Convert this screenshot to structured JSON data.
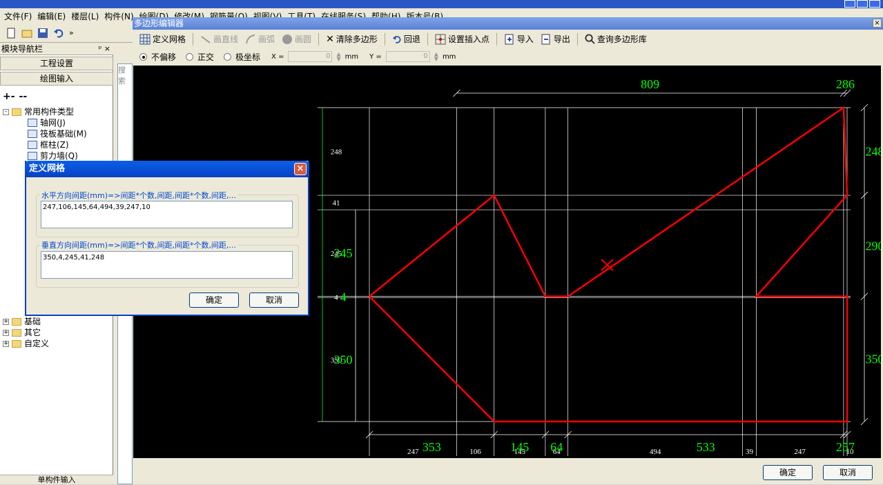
{
  "app": {
    "menu": [
      "文件(F)",
      "编辑(E)",
      "楼层(L)",
      "构件(N)",
      "绘图(D)",
      "修改(M)",
      "钢筋量(Q)",
      "视图(V)",
      "工具(T)",
      "在线服务(S)",
      "帮助(H)",
      "版本号(B)"
    ]
  },
  "nav": {
    "title": "模块导航栏",
    "pin": "ᵖ",
    "close": "×",
    "buttons": [
      "工程设置",
      "绘图输入"
    ],
    "tree": {
      "root": "常用构件类型",
      "children": [
        "轴网(J)",
        "筏板基础(M)",
        "框柱(Z)",
        "剪力墙(Q)"
      ],
      "folders": [
        "基础",
        "其它",
        "自定义"
      ]
    },
    "bottom": "单构件输入",
    "search_hint": "搜索"
  },
  "editor": {
    "title": "多边形编辑器",
    "close": "×",
    "toolbar": {
      "define_grid": "定义网格",
      "draw_line": "画直线",
      "draw_arc": "画弧",
      "draw_circle": "画圆",
      "clear_polygon": "清除多边形",
      "undo": "回退",
      "set_insert_point": "设置插入点",
      "import": "导入",
      "export": "导出",
      "query_library": "查询多边形库"
    },
    "options": {
      "no_offset": "不偏移",
      "orthogonal": "正交",
      "polar": "极坐标",
      "x_label": "X =",
      "x_value": "0",
      "y_label": "Y =",
      "y_value": "0",
      "unit": "mm",
      "selected": "no_offset"
    },
    "ok": "确定",
    "cancel": "取消"
  },
  "canvas_data": {
    "h_spacing": [
      247,
      106,
      145,
      64,
      494,
      39,
      247,
      10
    ],
    "v_spacing_bottom_up": [
      350,
      4,
      245,
      41,
      248
    ],
    "grid_labels_bottom": [
      "247",
      "106",
      "145",
      "64",
      "494",
      "39",
      "247",
      "10"
    ],
    "grid_labels_left": [
      "248",
      "41",
      "245",
      "4",
      "350"
    ],
    "dim_top": [
      "809",
      "286"
    ],
    "dim_bottom": [
      "353",
      "145",
      "64",
      "533",
      "257"
    ],
    "dim_left": [
      "245",
      "4",
      "350"
    ],
    "dim_right": [
      "248",
      "290",
      "350"
    ],
    "grid_color": "#ffffff",
    "poly_color": "#ff0000",
    "dim_color": "#00ff00"
  },
  "dialog": {
    "title": "定义网格",
    "close": "×",
    "h_label": "水平方向间距(mm)=>间距*个数,间距,间距*个数,间距,...",
    "h_value": "247,106,145,64,494,39,247,10",
    "v_label": "垂直方向间距(mm)=>间距*个数,间距,间距*个数,间距,...",
    "v_value": "350,4,245,41,248",
    "ok": "确定",
    "cancel": "取消"
  }
}
